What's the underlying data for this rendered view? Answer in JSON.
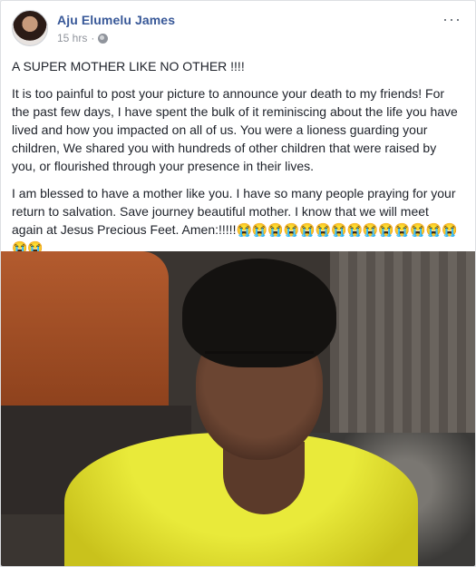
{
  "post": {
    "author": "Aju Elumelu James",
    "timestamp": "15 hrs",
    "separator": "·",
    "more_icon": "···",
    "paragraphs": [
      "A SUPER MOTHER LIKE NO OTHER !!!!",
      "It is too painful to post your picture to announce your death to my friends! For the past few days, I have spent the bulk of it reminiscing about the life you have lived and how you impacted on all of us. You were a lioness guarding your children, We shared you with hundreds of other children that were raised by you, or flourished through your presence in their lives.",
      "I am blessed to have a mother like you. I have so many people praying for your return to salvation. Save journey beautiful mother. I know that we will meet again at Jesus Precious Feet. Amen:!!!!!"
    ],
    "emoji_row": "😭😭😭😭😭😭😭😭😭😭😭😭😭😭😭😭",
    "icons": {
      "more": "more-options-icon",
      "privacy": "globe-icon"
    }
  },
  "colors": {
    "author": "#385898",
    "meta": "#90949c",
    "text": "#1d2129"
  }
}
